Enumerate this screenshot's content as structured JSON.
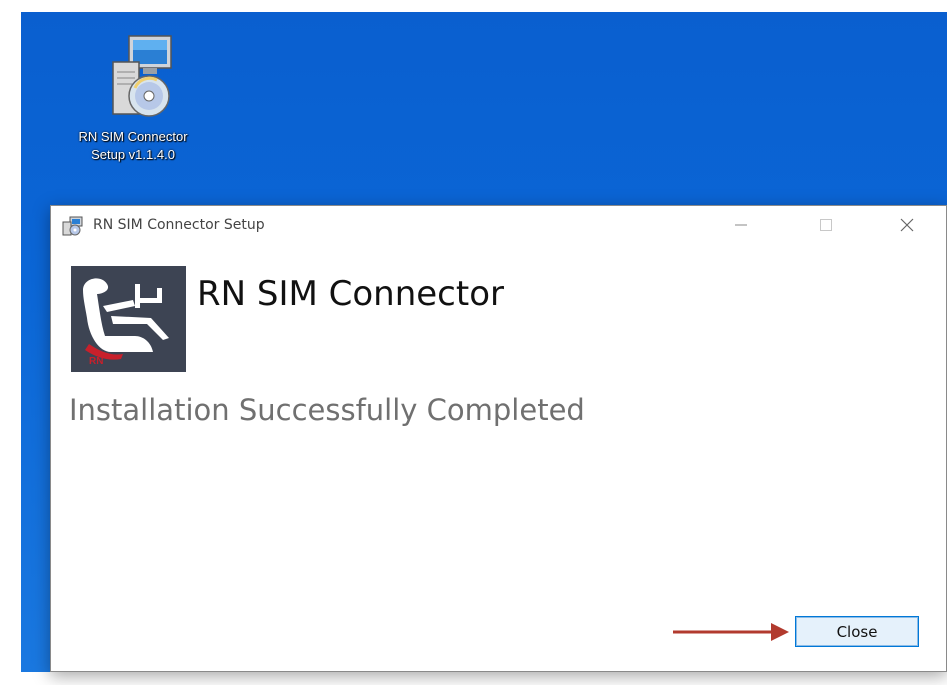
{
  "desktop": {
    "icon_label_line1": "RN SIM Connector",
    "icon_label_line2": "Setup v1.1.4.0",
    "icon": "installer-icon",
    "background_color": "#0b66d6"
  },
  "window": {
    "title": "RN SIM Connector Setup",
    "title_icon": "installer-icon",
    "minimize_icon": "minimize-icon",
    "maximize_icon": "maximize-icon",
    "close_icon": "close-icon"
  },
  "content": {
    "logo_text": "RN",
    "app_name": "RN SIM Connector",
    "status": "Installation Successfully Completed",
    "close_button_label": "Close"
  },
  "annotation": {
    "arrow_color": "#b23a2e",
    "icon": "arrow-right-icon"
  }
}
